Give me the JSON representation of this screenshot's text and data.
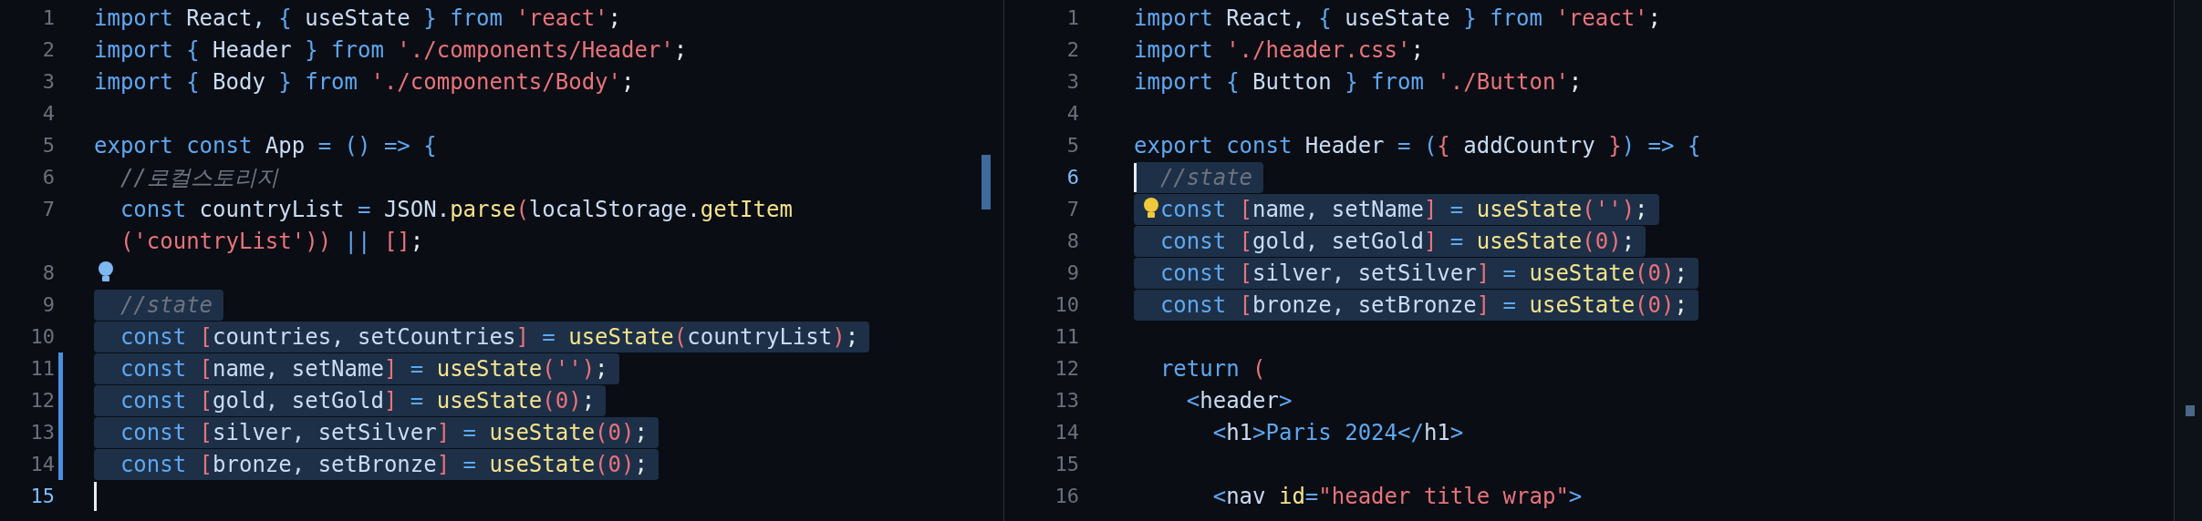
{
  "panes": [
    {
      "lines": [
        {
          "number": "1",
          "current": false,
          "modified": false,
          "highlighted": false,
          "lightbulb": false,
          "tokens": [
            {
              "kind": "kw",
              "text": "import"
            },
            {
              "kind": "id",
              "text": " React, "
            },
            {
              "kind": "op",
              "text": "{"
            },
            {
              "kind": "id",
              "text": " useState "
            },
            {
              "kind": "op",
              "text": "}"
            },
            {
              "kind": "kw",
              "text": " from "
            },
            {
              "kind": "str",
              "text": "'react'"
            },
            {
              "kind": "pl",
              "text": ";"
            }
          ]
        },
        {
          "number": "2",
          "current": false,
          "modified": false,
          "highlighted": false,
          "lightbulb": false,
          "tokens": [
            {
              "kind": "kw",
              "text": "import "
            },
            {
              "kind": "op",
              "text": "{"
            },
            {
              "kind": "id",
              "text": " Header "
            },
            {
              "kind": "op",
              "text": "}"
            },
            {
              "kind": "kw",
              "text": " from "
            },
            {
              "kind": "str",
              "text": "'./components/Header'"
            },
            {
              "kind": "pl",
              "text": ";"
            }
          ]
        },
        {
          "number": "3",
          "current": false,
          "modified": false,
          "highlighted": false,
          "lightbulb": false,
          "tokens": [
            {
              "kind": "kw",
              "text": "import "
            },
            {
              "kind": "op",
              "text": "{"
            },
            {
              "kind": "id",
              "text": " Body "
            },
            {
              "kind": "op",
              "text": "}"
            },
            {
              "kind": "kw",
              "text": " from "
            },
            {
              "kind": "str",
              "text": "'./components/Body'"
            },
            {
              "kind": "pl",
              "text": ";"
            }
          ]
        },
        {
          "number": "4",
          "current": false,
          "modified": false,
          "highlighted": false,
          "lightbulb": false
        },
        {
          "number": "5",
          "current": false,
          "modified": false,
          "highlighted": false,
          "lightbulb": false,
          "tokens": [
            {
              "kind": "kw",
              "text": "export const "
            },
            {
              "kind": "id",
              "text": "App "
            },
            {
              "kind": "op",
              "text": "= () => {"
            }
          ]
        },
        {
          "number": "6",
          "current": false,
          "modified": false,
          "highlighted": false,
          "lightbulb": false,
          "tokens": [
            {
              "kind": "cm",
              "text": "  //로컬스토리지"
            }
          ]
        },
        {
          "number": "7",
          "current": false,
          "modified": false,
          "highlighted": false,
          "lightbulb": false,
          "tokens": [
            {
              "kind": "kw",
              "text": "  const "
            },
            {
              "kind": "id",
              "text": "countryList "
            },
            {
              "kind": "op",
              "text": "= "
            },
            {
              "kind": "id",
              "text": "JSON."
            },
            {
              "kind": "fn",
              "text": "parse"
            },
            {
              "kind": "br",
              "text": "("
            },
            {
              "kind": "id",
              "text": "localStorage."
            },
            {
              "kind": "fn",
              "text": "getItem"
            }
          ]
        },
        {
          "current": false,
          "modified": false,
          "highlighted": false,
          "lightbulb": false,
          "tokens": [
            {
              "kind": "br",
              "text": "  ("
            },
            {
              "kind": "str",
              "text": "'countryList'"
            },
            {
              "kind": "br",
              "text": "))"
            },
            {
              "kind": "op",
              "text": " || "
            },
            {
              "kind": "br",
              "text": "[]"
            },
            {
              "kind": "pl",
              "text": ";"
            }
          ]
        },
        {
          "number": "8",
          "current": false,
          "modified": false,
          "highlighted": false,
          "lightbulb": true
        },
        {
          "number": "9",
          "current": false,
          "modified": false,
          "highlighted": true,
          "lightbulb": false,
          "tokens": [
            {
              "kind": "cm",
              "text": "  //state"
            }
          ]
        },
        {
          "number": "10",
          "current": false,
          "modified": false,
          "highlighted": true,
          "lightbulb": false,
          "tokens": [
            {
              "kind": "kw",
              "text": "  const "
            },
            {
              "kind": "br",
              "text": "["
            },
            {
              "kind": "id",
              "text": "countries, setCountries"
            },
            {
              "kind": "br",
              "text": "]"
            },
            {
              "kind": "op",
              "text": " = "
            },
            {
              "kind": "fn",
              "text": "useState"
            },
            {
              "kind": "br",
              "text": "("
            },
            {
              "kind": "id",
              "text": "countryList"
            },
            {
              "kind": "br",
              "text": ")"
            },
            {
              "kind": "pl",
              "text": ";"
            }
          ]
        },
        {
          "number": "11",
          "current": false,
          "modified": true,
          "highlighted": true,
          "lightbulb": false,
          "tokens": [
            {
              "kind": "kw",
              "text": "  const "
            },
            {
              "kind": "br",
              "text": "["
            },
            {
              "kind": "id",
              "text": "name, setName"
            },
            {
              "kind": "br",
              "text": "]"
            },
            {
              "kind": "op",
              "text": " = "
            },
            {
              "kind": "fn",
              "text": "useState"
            },
            {
              "kind": "br",
              "text": "("
            },
            {
              "kind": "str",
              "text": "''"
            },
            {
              "kind": "br",
              "text": ")"
            },
            {
              "kind": "pl",
              "text": ";"
            }
          ]
        },
        {
          "number": "12",
          "current": false,
          "modified": true,
          "highlighted": true,
          "lightbulb": false,
          "tokens": [
            {
              "kind": "kw",
              "text": "  const "
            },
            {
              "kind": "br",
              "text": "["
            },
            {
              "kind": "id",
              "text": "gold, setGold"
            },
            {
              "kind": "br",
              "text": "]"
            },
            {
              "kind": "op",
              "text": " = "
            },
            {
              "kind": "fn",
              "text": "useState"
            },
            {
              "kind": "br",
              "text": "("
            },
            {
              "kind": "num",
              "text": "0"
            },
            {
              "kind": "br",
              "text": ")"
            },
            {
              "kind": "pl",
              "text": ";"
            }
          ]
        },
        {
          "number": "13",
          "current": false,
          "modified": true,
          "highlighted": true,
          "lightbulb": false,
          "tokens": [
            {
              "kind": "kw",
              "text": "  const "
            },
            {
              "kind": "br",
              "text": "["
            },
            {
              "kind": "id",
              "text": "silver, setSilver"
            },
            {
              "kind": "br",
              "text": "]"
            },
            {
              "kind": "op",
              "text": " = "
            },
            {
              "kind": "fn",
              "text": "useState"
            },
            {
              "kind": "br",
              "text": "("
            },
            {
              "kind": "num",
              "text": "0"
            },
            {
              "kind": "br",
              "text": ")"
            },
            {
              "kind": "pl",
              "text": ";"
            }
          ]
        },
        {
          "number": "14",
          "current": false,
          "modified": true,
          "highlighted": true,
          "lightbulb": false,
          "tokens": [
            {
              "kind": "kw",
              "text": "  const "
            },
            {
              "kind": "br",
              "text": "["
            },
            {
              "kind": "id",
              "text": "bronze, setBronze"
            },
            {
              "kind": "br",
              "text": "]"
            },
            {
              "kind": "op",
              "text": " = "
            },
            {
              "kind": "fn",
              "text": "useState"
            },
            {
              "kind": "br",
              "text": "("
            },
            {
              "kind": "num",
              "text": "0"
            },
            {
              "kind": "br",
              "text": ")"
            },
            {
              "kind": "pl",
              "text": ";"
            }
          ]
        },
        {
          "number": "15",
          "current": true,
          "modified": false,
          "highlighted": false,
          "lightbulb": false
        }
      ]
    },
    {
      "lines": [
        {
          "number": "1",
          "current": false,
          "modified": false,
          "highlighted": false,
          "lightbulb": false,
          "tokens": [
            {
              "kind": "kw",
              "text": "import"
            },
            {
              "kind": "id",
              "text": " React, "
            },
            {
              "kind": "op",
              "text": "{"
            },
            {
              "kind": "id",
              "text": " useState "
            },
            {
              "kind": "op",
              "text": "}"
            },
            {
              "kind": "kw",
              "text": " from "
            },
            {
              "kind": "str",
              "text": "'react'"
            },
            {
              "kind": "pl",
              "text": ";"
            }
          ]
        },
        {
          "number": "2",
          "current": false,
          "modified": false,
          "highlighted": false,
          "lightbulb": false,
          "tokens": [
            {
              "kind": "kw",
              "text": "import "
            },
            {
              "kind": "str",
              "text": "'./header.css'"
            },
            {
              "kind": "pl",
              "text": ";"
            }
          ]
        },
        {
          "number": "3",
          "current": false,
          "modified": false,
          "highlighted": false,
          "lightbulb": false,
          "tokens": [
            {
              "kind": "kw",
              "text": "import "
            },
            {
              "kind": "op",
              "text": "{"
            },
            {
              "kind": "id",
              "text": " Button "
            },
            {
              "kind": "op",
              "text": "}"
            },
            {
              "kind": "kw",
              "text": " from "
            },
            {
              "kind": "str",
              "text": "'./Button'"
            },
            {
              "kind": "pl",
              "text": ";"
            }
          ]
        },
        {
          "number": "4",
          "current": false,
          "modified": false,
          "highlighted": false,
          "lightbulb": false
        },
        {
          "number": "5",
          "current": false,
          "modified": false,
          "highlighted": false,
          "lightbulb": false,
          "tokens": [
            {
              "kind": "kw",
              "text": "export const "
            },
            {
              "kind": "id",
              "text": "Header "
            },
            {
              "kind": "op",
              "text": "= ("
            },
            {
              "kind": "br",
              "text": "{"
            },
            {
              "kind": "id",
              "text": " addCountry "
            },
            {
              "kind": "br",
              "text": "}"
            },
            {
              "kind": "op",
              "text": ") => {"
            }
          ]
        },
        {
          "number": "6",
          "current": true,
          "modified": false,
          "highlighted": true,
          "lightbulb": false,
          "tokens": [
            {
              "kind": "cm",
              "text": "  //state"
            }
          ]
        },
        {
          "number": "7",
          "current": false,
          "modified": false,
          "highlighted": true,
          "lightbulb": true,
          "tokens": [
            {
              "kind": "kw",
              "text": "  const "
            },
            {
              "kind": "br",
              "text": "["
            },
            {
              "kind": "id",
              "text": "name, setName"
            },
            {
              "kind": "br",
              "text": "]"
            },
            {
              "kind": "op",
              "text": " = "
            },
            {
              "kind": "fn",
              "text": "useState"
            },
            {
              "kind": "br",
              "text": "("
            },
            {
              "kind": "str",
              "text": "''"
            },
            {
              "kind": "br",
              "text": ")"
            },
            {
              "kind": "pl",
              "text": ";"
            }
          ]
        },
        {
          "number": "8",
          "current": false,
          "modified": false,
          "highlighted": true,
          "lightbulb": false,
          "tokens": [
            {
              "kind": "kw",
              "text": "  const "
            },
            {
              "kind": "br",
              "text": "["
            },
            {
              "kind": "id",
              "text": "gold, setGold"
            },
            {
              "kind": "br",
              "text": "]"
            },
            {
              "kind": "op",
              "text": " = "
            },
            {
              "kind": "fn",
              "text": "useState"
            },
            {
              "kind": "br",
              "text": "("
            },
            {
              "kind": "num",
              "text": "0"
            },
            {
              "kind": "br",
              "text": ")"
            },
            {
              "kind": "pl",
              "text": ";"
            }
          ]
        },
        {
          "number": "9",
          "current": false,
          "modified": false,
          "highlighted": true,
          "lightbulb": false,
          "tokens": [
            {
              "kind": "kw",
              "text": "  const "
            },
            {
              "kind": "br",
              "text": "["
            },
            {
              "kind": "id",
              "text": "silver, setSilver"
            },
            {
              "kind": "br",
              "text": "]"
            },
            {
              "kind": "op",
              "text": " = "
            },
            {
              "kind": "fn",
              "text": "useState"
            },
            {
              "kind": "br",
              "text": "("
            },
            {
              "kind": "num",
              "text": "0"
            },
            {
              "kind": "br",
              "text": ")"
            },
            {
              "kind": "pl",
              "text": ";"
            }
          ]
        },
        {
          "number": "10",
          "current": false,
          "modified": false,
          "highlighted": true,
          "lightbulb": false,
          "tokens": [
            {
              "kind": "kw",
              "text": "  const "
            },
            {
              "kind": "br",
              "text": "["
            },
            {
              "kind": "id",
              "text": "bronze, setBronze"
            },
            {
              "kind": "br",
              "text": "]"
            },
            {
              "kind": "op",
              "text": " = "
            },
            {
              "kind": "fn",
              "text": "useState"
            },
            {
              "kind": "br",
              "text": "("
            },
            {
              "kind": "num",
              "text": "0"
            },
            {
              "kind": "br",
              "text": ")"
            },
            {
              "kind": "pl",
              "text": ";"
            }
          ]
        },
        {
          "number": "11",
          "current": false,
          "modified": false,
          "highlighted": false,
          "lightbulb": false
        },
        {
          "number": "12",
          "current": false,
          "modified": false,
          "highlighted": false,
          "lightbulb": false,
          "tokens": [
            {
              "kind": "kw",
              "text": "  return "
            },
            {
              "kind": "br",
              "text": "("
            }
          ]
        },
        {
          "number": "13",
          "current": false,
          "modified": false,
          "highlighted": false,
          "lightbulb": false,
          "tokens": [
            {
              "kind": "op",
              "text": "    <"
            },
            {
              "kind": "id",
              "text": "header"
            },
            {
              "kind": "op",
              "text": ">"
            }
          ]
        },
        {
          "number": "14",
          "current": false,
          "modified": false,
          "highlighted": false,
          "lightbulb": false,
          "tokens": [
            {
              "kind": "op",
              "text": "      <"
            },
            {
              "kind": "id",
              "text": "h1"
            },
            {
              "kind": "op",
              "text": ">"
            },
            {
              "kind": "kw",
              "text": "Paris 2024"
            },
            {
              "kind": "op",
              "text": "</"
            },
            {
              "kind": "id",
              "text": "h1"
            },
            {
              "kind": "op",
              "text": ">"
            }
          ]
        },
        {
          "number": "15",
          "current": false,
          "modified": false,
          "highlighted": false,
          "lightbulb": false
        },
        {
          "number": "16",
          "current": false,
          "modified": false,
          "highlighted": false,
          "lightbulb": false,
          "tokens": [
            {
              "kind": "op",
              "text": "      <"
            },
            {
              "kind": "id",
              "text": "nav "
            },
            {
              "kind": "fn",
              "text": "id"
            },
            {
              "kind": "op",
              "text": "="
            },
            {
              "kind": "str",
              "text": "\"header title wrap\""
            },
            {
              "kind": "op",
              "text": ">"
            }
          ]
        }
      ]
    }
  ]
}
